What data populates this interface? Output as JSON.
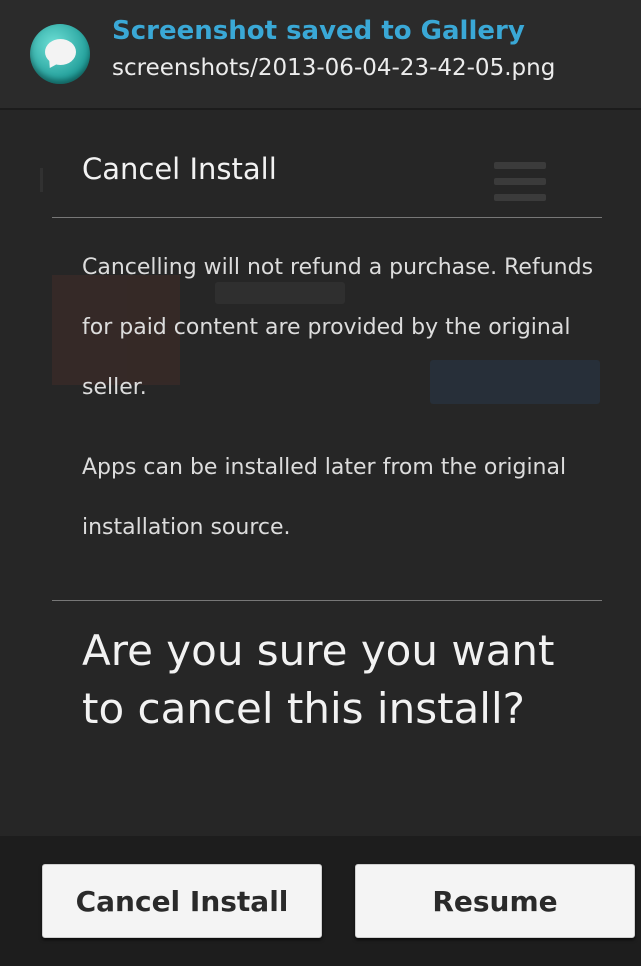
{
  "notification": {
    "title": "Screenshot saved to Gallery",
    "subtitle": "screenshots/2013-06-04-23-42-05.png",
    "icon": "message-bubble-icon",
    "title_color": "#3aa8d6"
  },
  "dialog": {
    "title": "Cancel Install",
    "paragraph_1": "Cancelling will not refund a purchase. Refunds for paid content are provided by the original seller.",
    "paragraph_2": "Apps can be installed later from the original installation source.",
    "question": "Are you sure you want to cancel this install?"
  },
  "buttons": {
    "cancel_label": "Cancel Install",
    "resume_label": "Resume"
  }
}
